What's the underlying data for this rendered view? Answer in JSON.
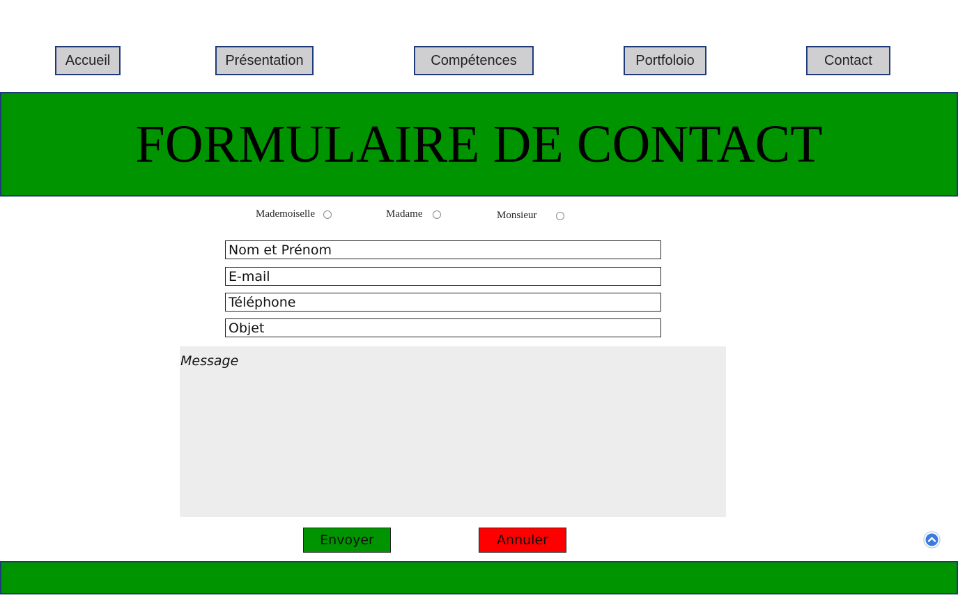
{
  "nav": {
    "items": [
      {
        "label": "Accueil"
      },
      {
        "label": "Présentation"
      },
      {
        "label": "Compétences"
      },
      {
        "label": "Portfoloio"
      },
      {
        "label": "Contact"
      }
    ]
  },
  "banner": {
    "title": "FORMULAIRE DE CONTACT"
  },
  "civility": {
    "options": [
      {
        "label": "Mademoiselle",
        "selected": false
      },
      {
        "label": "Madame",
        "selected": false
      },
      {
        "label": "Monsieur",
        "selected": false
      }
    ]
  },
  "form": {
    "name_field": "Nom et Prénom",
    "email_field": "E-mail",
    "phone_field": "Téléphone",
    "subject_field": "Objet",
    "message_label": "Message"
  },
  "actions": {
    "send_label": "Envoyer",
    "cancel_label": "Annuler"
  },
  "icons": {
    "scroll_top": "chevron-up-circle-icon"
  },
  "colors": {
    "banner_green": "#009400",
    "nav_border": "#1f3a7a",
    "send_green": "#009400",
    "cancel_red": "#ff0000",
    "message_bg": "#ededed"
  }
}
